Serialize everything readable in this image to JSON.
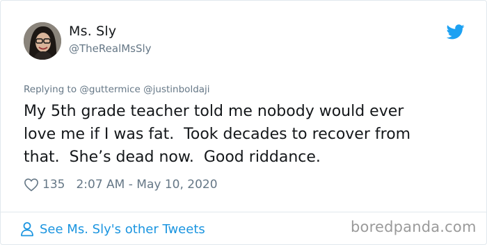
{
  "author": {
    "name": "Ms. Sly",
    "handle": "@TheRealMsSly"
  },
  "reply": {
    "prefix": "Replying to ",
    "mentions": [
      "@guttermice",
      "@justinboldaji"
    ]
  },
  "tweet": {
    "lines": [
      "My 5th grade teacher told me nobody would ever",
      "love me if I was fat.  Took decades to recover from",
      "that.  She’s dead now.  Good riddance."
    ]
  },
  "meta": {
    "likes": "135",
    "timestamp": "2:07 AM - May 10, 2020"
  },
  "footer": {
    "link_label": "See Ms. Sly's other Tweets",
    "watermark": "boredpanda.com"
  },
  "icons": {
    "bird": "twitter-bird-icon",
    "heart": "heart-icon",
    "person": "person-icon"
  },
  "colors": {
    "accent": "#1b95e0",
    "twitter_blue": "#1da1f2",
    "secondary_text": "#657786",
    "divider": "#e1e8ed"
  }
}
